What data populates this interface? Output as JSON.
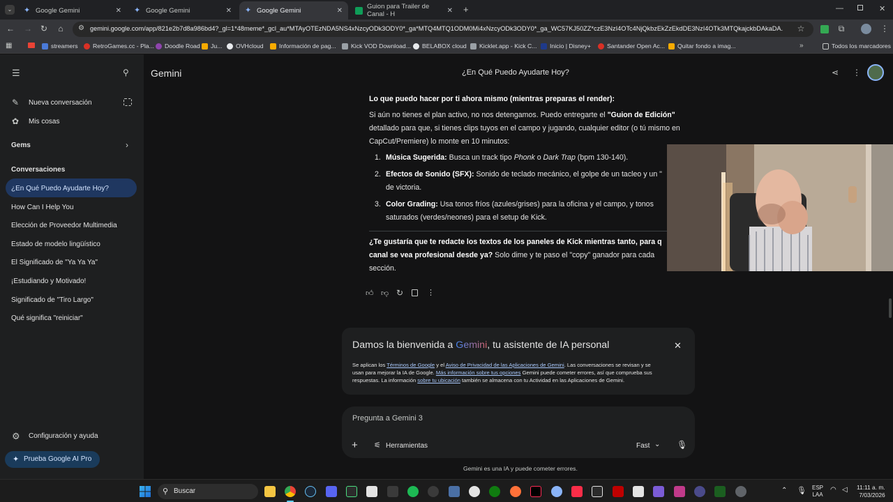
{
  "browser": {
    "tabs": [
      {
        "title": "Google Gemini",
        "active": false
      },
      {
        "title": "Google Gemini",
        "active": false
      },
      {
        "title": "Google Gemini",
        "active": true
      },
      {
        "title": "Guion para Trailer de Canal - H",
        "active": false
      }
    ],
    "url": "gemini.google.com/app/821e2b7d8a986bd4?_gl=1*48meme*_gcl_au*MTAyOTEzNDA5NS4xNzcyODk3ODY0*_ga*MTQ4MTQ1ODM0Mi4xNzcyODk3ODY0*_ga_WC57KJ50ZZ*czE3NzI4OTc4NjQkbzEkZzEkdDE3NzI4OTk3MTQkajckbDAkaDA.",
    "bookmarks": [
      "streamers",
      "RetroGames.cc - Pla...",
      "Doodle Road",
      "Ju...",
      "OVHcloud",
      "Información de pag...",
      "Kick VOD Download...",
      "BELABOX cloud",
      "Kicklet.app - Kick C...",
      "Inicio | Disney+",
      "Santander Open Ac...",
      "Quitar fondo a imag..."
    ],
    "all_bookmarks": "Todos los marcadores"
  },
  "sidebar": {
    "new_chat": "Nueva conversación",
    "my_stuff": "Mis cosas",
    "gems": "Gems",
    "conversations_heading": "Conversaciones",
    "conversations": [
      "¿En Qué Puedo Ayudarte Hoy?",
      "How Can I Help You",
      "Elección de Proveedor Multimedia",
      "Estado de modelo lingüístico",
      "El Significado de \"Ya Ya Ya\"",
      "¡Estudiando y Motivado!",
      "Significado de \"Tiro Largo\"",
      "Qué significa \"reiniciar\""
    ],
    "settings": "Configuración y ayuda",
    "upgrade": "Prueba Google AI Pro"
  },
  "header": {
    "app_name": "Gemini",
    "chat_title": "¿En Qué Puedo Ayudarte Hoy?"
  },
  "response": {
    "heading": "Lo que puedo hacer por ti ahora mismo (mientras preparas el render):",
    "p1_a": "Si aún no tienes el plan activo, no nos detengamos. Puedo entregarte el ",
    "p1_b": "\"Guion de Edición\"",
    "p1_line2": "detallado para que, si tienes clips tuyos en el campo y jugando, cualquier editor (o tú mismo en",
    "p1_line3": "CapCut/Premiere) lo monte en 10 minutos:",
    "items": [
      {
        "num": "1.",
        "label": "Música Sugerida:",
        "t1": " Busca un track tipo ",
        "i1": "Phonk",
        "t2": " o ",
        "i2": "Dark Trap",
        "t3": " (bpm 130-140)."
      },
      {
        "num": "2.",
        "label": "Efectos de Sonido (SFX):",
        "line1": " Sonido de teclado mecánico, el golpe de un tacleo y un \"",
        "line2": "de victoria."
      },
      {
        "num": "3.",
        "label": "Color Grading:",
        "line1": " Usa tonos fríos (azules/grises) para la oficina y el campo, y tonos",
        "line2": "saturados (verdes/neones) para el setup de Kick."
      }
    ],
    "q_bold1": "¿Te gustaría que te redacte los textos de los paneles de Kick mientras tanto, para q",
    "q_bold2": "canal se vea profesional desde ya?",
    "q_rest": " Solo dime y te paso el \"copy\" ganador para cada",
    "q_line3": "sección."
  },
  "welcome": {
    "title_a": "Damos la bienvenida a ",
    "title_brand": "Gemini",
    "title_b": ", tu asistente de IA personal",
    "l1_a": "Se aplican los ",
    "l1_link1": "Términos de Google",
    "l1_b": " y el ",
    "l1_link2": "Aviso de Privacidad de las Aplicaciones de Gemini",
    "l1_c": ". Las conversaciones se revisan y se",
    "l2_a": "usan para mejorar la IA de Google. ",
    "l2_link": "Más información sobre tus opciones",
    "l2_b": " Gemini puede cometer errores, así que comprueba sus",
    "l3_a": "respuestas. La información ",
    "l3_link": "sobre tu ubicación",
    "l3_b": " también se almacena con tu Actividad en las Aplicaciones de Gemini."
  },
  "input": {
    "placeholder": "Pregunta a Gemini 3",
    "tools": "Herramientas",
    "mode": "Fast"
  },
  "footer_note": "Gemini es una IA y puede cometer errores.",
  "taskbar": {
    "search": "Buscar",
    "lang1": "ESP",
    "lang2": "LAA",
    "time": "11:11 a. m.",
    "date": "7/03/2026"
  },
  "colors": {
    "accent": "#1f3760",
    "brand_gradient_start": "#4285f4",
    "brand_gradient_end": "#d96570",
    "link": "#a8c7fa"
  }
}
